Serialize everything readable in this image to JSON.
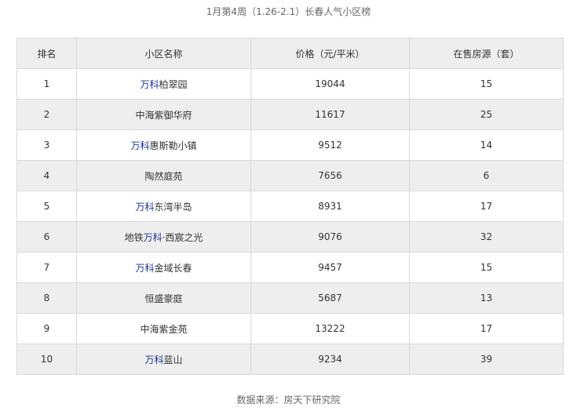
{
  "title": "1月第4周（1.26-2.1）长春人气小区榜",
  "table": {
    "headers": [
      "排名",
      "小区名称",
      "价格（元/平米）",
      "在售房源（套）"
    ],
    "rows": [
      {
        "rank": "1",
        "name_prefix": "",
        "brand": "万科",
        "name_suffix": "柏翠园",
        "price": "19044",
        "listings": "15"
      },
      {
        "rank": "2",
        "name_prefix": "",
        "brand": "",
        "name_suffix": "中海紫御华府",
        "price": "11617",
        "listings": "25"
      },
      {
        "rank": "3",
        "name_prefix": "",
        "brand": "万科",
        "name_suffix": "惠斯勒小镇",
        "price": "9512",
        "listings": "14"
      },
      {
        "rank": "4",
        "name_prefix": "",
        "brand": "",
        "name_suffix": "陶然庭苑",
        "price": "7656",
        "listings": "6"
      },
      {
        "rank": "5",
        "name_prefix": "",
        "brand": "万科",
        "name_suffix": "东湾半岛",
        "price": "8931",
        "listings": "17"
      },
      {
        "rank": "6",
        "name_prefix": "地铁",
        "brand": "万科",
        "name_suffix": "·西宸之光",
        "price": "9076",
        "listings": "32"
      },
      {
        "rank": "7",
        "name_prefix": "",
        "brand": "万科",
        "name_suffix": "金域长春",
        "price": "9457",
        "listings": "15"
      },
      {
        "rank": "8",
        "name_prefix": "",
        "brand": "",
        "name_suffix": "恒盛豪庭",
        "price": "5687",
        "listings": "13"
      },
      {
        "rank": "9",
        "name_prefix": "",
        "brand": "",
        "name_suffix": "中海紫金苑",
        "price": "13222",
        "listings": "17"
      },
      {
        "rank": "10",
        "name_prefix": "",
        "brand": "万科",
        "name_suffix": "蓝山",
        "price": "9234",
        "listings": "39"
      }
    ]
  },
  "source": "数据来源：房天下研究院",
  "colors": {
    "brand_link": "#1a3399",
    "header_bg": "#eeeeee",
    "stripe_bg": "#eeeeee",
    "border": "#d9d9d9"
  }
}
